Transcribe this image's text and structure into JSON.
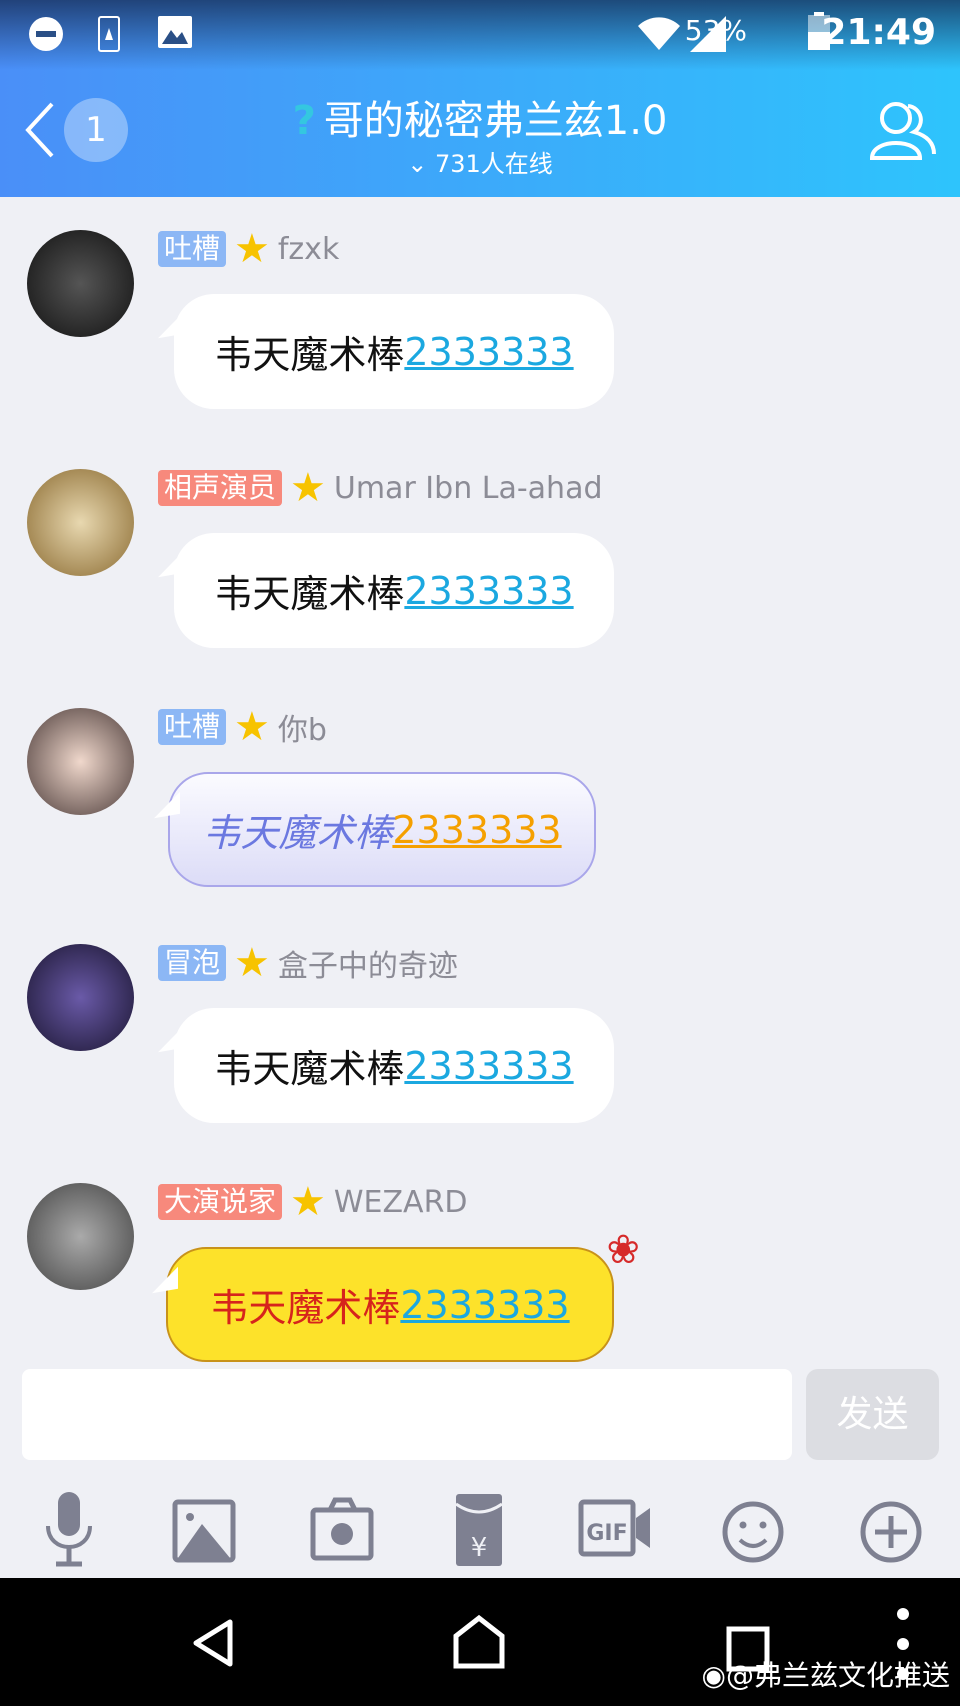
{
  "status_bar": {
    "battery": "53%",
    "time": "21:49"
  },
  "header": {
    "back_count": "1",
    "title": "哥的秘密弗兰兹1.0",
    "title_prefix": "?",
    "online": "731人在线"
  },
  "messages": [
    {
      "tag": "吐槽",
      "tag_color": "#8cb7f5",
      "nick": "fzxk",
      "text": "韦天魔术棒",
      "link": "2333333",
      "style": "plain"
    },
    {
      "tag": "相声演员",
      "tag_color": "#f7897c",
      "nick": "Umar Ibn La-ahad",
      "text": "韦天魔术棒",
      "link": "2333333",
      "style": "plain"
    },
    {
      "tag": "吐槽",
      "tag_color": "#8cb7f5",
      "nick": "你b",
      "text": "韦天魔术棒",
      "link": "2333333",
      "style": "purple"
    },
    {
      "tag": "冒泡",
      "tag_color": "#8cb7f5",
      "nick": "盒子中的奇迹",
      "text": "韦天魔术棒",
      "link": "2333333",
      "style": "plain"
    },
    {
      "tag": "大演说家",
      "tag_color": "#f7897c",
      "nick": "WEZARD",
      "text": "韦天魔术棒",
      "link": "2333333",
      "style": "yellow"
    }
  ],
  "input": {
    "value": "",
    "send_label": "发送"
  },
  "toolbar": [
    "mic-icon",
    "image-icon",
    "camera-icon",
    "red-packet-icon",
    "gif-icon",
    "emoji-icon",
    "plus-icon"
  ],
  "watermark": "@弗兰兹文化推送"
}
